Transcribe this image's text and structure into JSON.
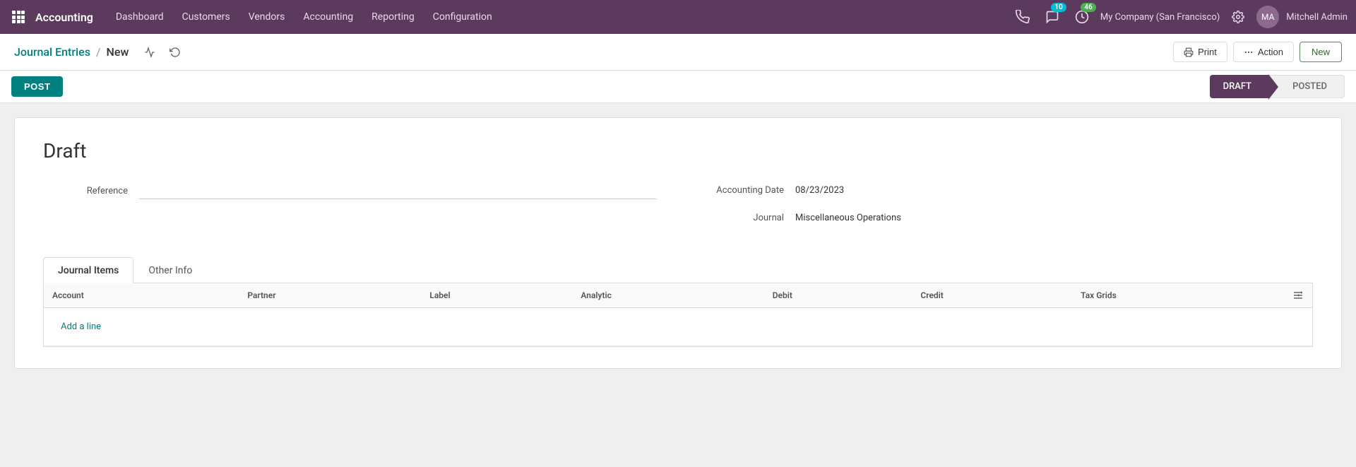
{
  "topnav": {
    "brand": "Accounting",
    "menu_items": [
      {
        "label": "Dashboard",
        "active": false
      },
      {
        "label": "Customers",
        "active": false
      },
      {
        "label": "Vendors",
        "active": false
      },
      {
        "label": "Accounting",
        "active": false
      },
      {
        "label": "Reporting",
        "active": false
      },
      {
        "label": "Configuration",
        "active": false
      }
    ],
    "messages_badge": "10",
    "activity_badge": "46",
    "company": "My Company (San Francisco)",
    "user": "Mitchell Admin"
  },
  "breadcrumb": {
    "parent_label": "Journal Entries",
    "separator": "/",
    "current_label": "New"
  },
  "toolbar": {
    "print_label": "Print",
    "action_label": "Action",
    "new_label": "New"
  },
  "status": {
    "post_button": "POST",
    "draft_label": "DRAFT",
    "posted_label": "POSTED"
  },
  "form": {
    "title": "Draft",
    "reference_label": "Reference",
    "reference_value": "",
    "reference_placeholder": "",
    "accounting_date_label": "Accounting Date",
    "accounting_date_value": "08/23/2023",
    "journal_label": "Journal",
    "journal_value": "Miscellaneous Operations"
  },
  "tabs": [
    {
      "label": "Journal Items",
      "active": true
    },
    {
      "label": "Other Info",
      "active": false
    }
  ],
  "table": {
    "columns": [
      {
        "label": "Account"
      },
      {
        "label": "Partner"
      },
      {
        "label": "Label"
      },
      {
        "label": "Analytic"
      },
      {
        "label": "Debit",
        "align": "right"
      },
      {
        "label": "Credit",
        "align": "right"
      },
      {
        "label": "Tax Grids"
      }
    ],
    "add_line_label": "Add a line"
  }
}
